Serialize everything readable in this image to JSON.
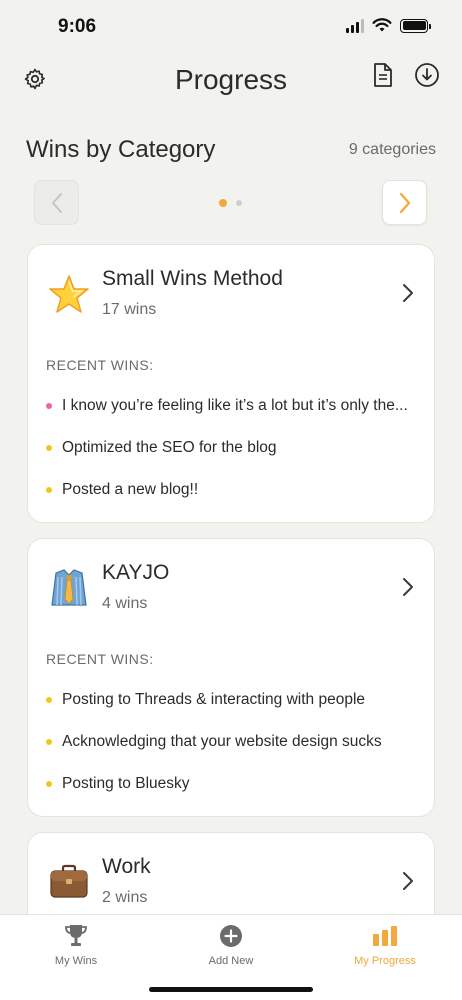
{
  "status_bar": {
    "time": "9:06"
  },
  "header": {
    "title": "Progress",
    "icons": [
      "gear-icon",
      "document-icon",
      "download-icon"
    ]
  },
  "section": {
    "title": "Wins by Category",
    "count": "9 categories"
  },
  "pager": {
    "pages": 2,
    "current": 1
  },
  "colors": {
    "accent": "#f0a93a",
    "bullet_pink": "#f061a8",
    "bullet_yellow": "#f5c518"
  },
  "cards": [
    {
      "title": "Small Wins Method",
      "subtitle": "17 wins",
      "emoji_icon": "star-icon",
      "recent_label": "RECENT WINS:",
      "wins": [
        {
          "text": "I know you’re feeling like it’s a lot but it’s only the...",
          "bullet": "pink"
        },
        {
          "text": "Optimized the SEO for the blog",
          "bullet": "yellow"
        },
        {
          "text": "Posted a new blog!!",
          "bullet": "yellow"
        }
      ]
    },
    {
      "title": "KAYJO",
      "subtitle": "4 wins",
      "emoji_icon": "shirt-tie-icon",
      "recent_label": "RECENT WINS:",
      "wins": [
        {
          "text": "Posting to Threads & interacting with people",
          "bullet": "yellow"
        },
        {
          "text": "Acknowledging that your website design sucks",
          "bullet": "yellow"
        },
        {
          "text": "Posting to Bluesky",
          "bullet": "yellow"
        }
      ]
    },
    {
      "title": "Work",
      "subtitle": "2 wins",
      "emoji_icon": "briefcase-icon"
    }
  ],
  "tabbar": {
    "tabs": [
      {
        "label": "My Wins",
        "icon": "trophy-icon",
        "active": false
      },
      {
        "label": "Add New",
        "icon": "plus-circle-icon",
        "active": false
      },
      {
        "label": "My Progress",
        "icon": "bar-chart-icon",
        "active": true
      }
    ]
  }
}
